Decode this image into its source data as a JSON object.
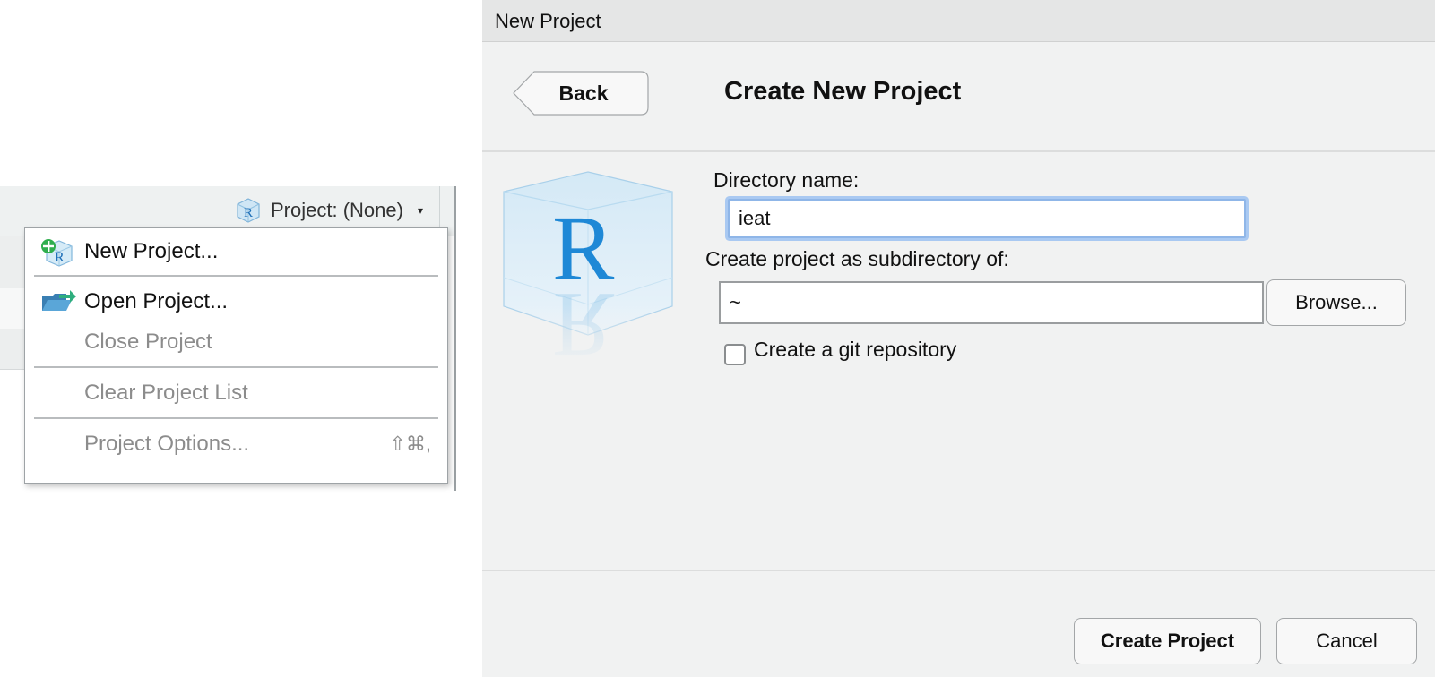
{
  "project_toolbar": {
    "label": "Project: (None)",
    "icon": "r-project-icon",
    "caret": "▾"
  },
  "project_menu": {
    "items": [
      {
        "label": "New Project...",
        "icon": "new-project-icon",
        "enabled": true
      },
      {
        "label": "Open Project...",
        "icon": "open-project-icon",
        "enabled": true
      },
      {
        "label": "Close Project",
        "enabled": false
      },
      {
        "label": "Clear Project List",
        "enabled": false
      },
      {
        "label": "Project Options...",
        "shortcut": "⇧⌘,",
        "enabled": false
      }
    ]
  },
  "dialog": {
    "window_title": "New Project",
    "back_label": "Back",
    "heading": "Create New Project",
    "directory_label": "Directory name:",
    "directory_value": "ieat",
    "subdirectory_label": "Create project as subdirectory of:",
    "subdirectory_value": "~",
    "browse_label": "Browse...",
    "git_label": "Create a git repository",
    "git_checked": false,
    "create_label": "Create Project",
    "cancel_label": "Cancel",
    "logo_letter": "R"
  },
  "colors": {
    "dialog_bg": "#f1f2f2",
    "focus_ring": "#a9c9f2",
    "r_logo_blue": "#1e88d6",
    "disabled_text": "#8c8c8c"
  }
}
